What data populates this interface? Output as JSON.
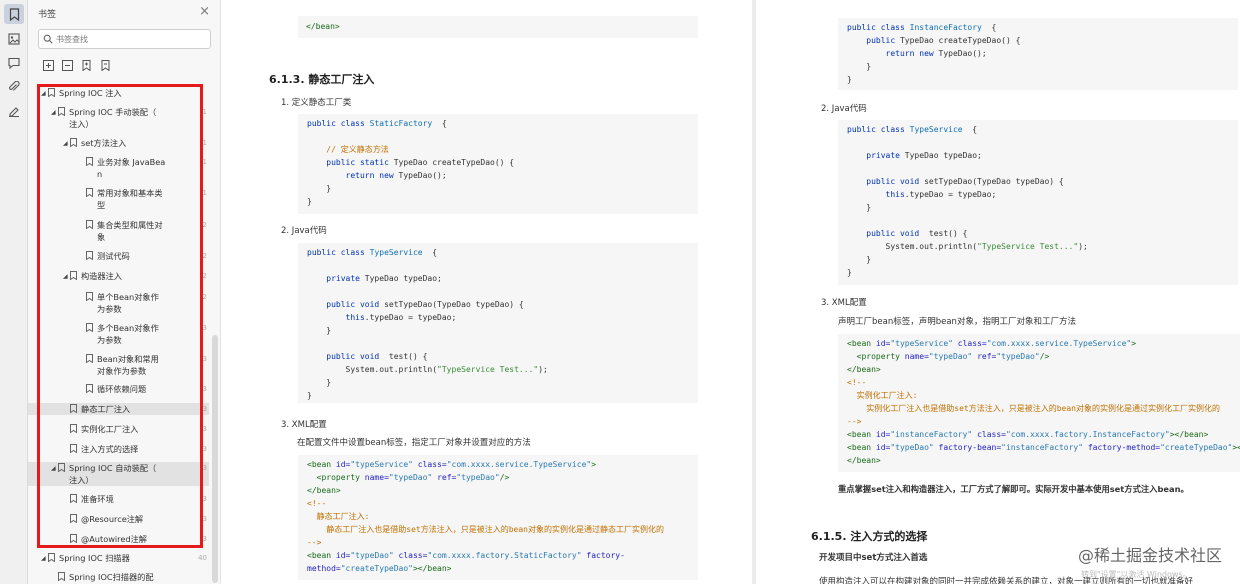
{
  "panel": {
    "title": "书签",
    "close": "×",
    "search_placeholder": "书签查找"
  },
  "tree": [
    {
      "label": "Spring IOC 注入",
      "level": 0,
      "exp": "open",
      "page": ""
    },
    {
      "label": "Spring IOC 手动装配（\n注入）",
      "level": 1,
      "exp": "open",
      "page": "1"
    },
    {
      "label": "set方法注入",
      "level": 2,
      "exp": "open",
      "page": "1"
    },
    {
      "label": "业务对象 JavaBea\nn",
      "level": 3,
      "exp": "",
      "page": "1"
    },
    {
      "label": "常用对象和基本类\n型",
      "level": 3,
      "exp": "",
      "page": "1"
    },
    {
      "label": "集合类型和属性对\n象",
      "level": 3,
      "exp": "",
      "page": "2"
    },
    {
      "label": "测试代码",
      "level": 3,
      "exp": "",
      "page": "2"
    },
    {
      "label": "构造器注入",
      "level": 2,
      "exp": "open",
      "page": "2"
    },
    {
      "label": "单个Bean对象作\n为参数",
      "level": 3,
      "exp": "",
      "page": "2"
    },
    {
      "label": "多个Bean对象作\n为参数",
      "level": 3,
      "exp": "",
      "page": "3"
    },
    {
      "label": "Bean对象和常用\n对象作为参数",
      "level": 3,
      "exp": "",
      "page": "3"
    },
    {
      "label": "循环依赖问题",
      "level": 3,
      "exp": "",
      "page": "3"
    },
    {
      "label": "静态工厂注入",
      "level": 2,
      "exp": "",
      "page": "3"
    },
    {
      "label": "实例化工厂注入",
      "level": 2,
      "exp": "",
      "page": "3"
    },
    {
      "label": "注入方式的选择",
      "level": 2,
      "exp": "",
      "page": "3"
    },
    {
      "label": "Spring IOC 自动装配（\n注入）",
      "level": 1,
      "exp": "open",
      "page": "3"
    },
    {
      "label": "准备环境",
      "level": 2,
      "exp": "",
      "page": "3"
    },
    {
      "label": "@Resource注解",
      "level": 2,
      "exp": "",
      "page": "3"
    },
    {
      "label": "@Autowired注解",
      "level": 2,
      "exp": "",
      "page": "3"
    },
    {
      "label": "Spring IOC 扫描器",
      "level": 0,
      "exp": "open",
      "page": "40"
    },
    {
      "label": "Spring IOC扫描器的配",
      "level": 1,
      "exp": "",
      "page": ""
    }
  ],
  "doc": {
    "p1_top_code": "</bean>",
    "h613": "6.1.3. 静态工厂注入",
    "i1": "1.   定义静态工厂类",
    "code1": [
      [
        [
          "kw",
          "public class "
        ],
        [
          "ty",
          "StaticFactory"
        ],
        [
          "",
          "  {"
        ]
      ],
      [
        [
          "",
          ""
        ]
      ],
      [
        [
          "cm",
          "    // 定义静态方法"
        ]
      ],
      [
        [
          "kw",
          "    public static "
        ],
        [
          "",
          "TypeDao createTypeDao() {"
        ]
      ],
      [
        [
          "kw",
          "        return new "
        ],
        [
          "",
          "TypeDao();"
        ]
      ],
      [
        [
          "",
          "    }"
        ]
      ],
      [
        [
          "",
          "}"
        ]
      ]
    ],
    "i2": "2.   Java代码",
    "code2": [
      [
        [
          "kw",
          "public class "
        ],
        [
          "ty",
          "TypeService"
        ],
        [
          "",
          "  {"
        ]
      ],
      [
        [
          "",
          ""
        ]
      ],
      [
        [
          "kw",
          "    private "
        ],
        [
          "",
          "TypeDao typeDao;"
        ]
      ],
      [
        [
          "",
          ""
        ]
      ],
      [
        [
          "kw",
          "    public void "
        ],
        [
          "",
          "setTypeDao(TypeDao typeDao) {"
        ]
      ],
      [
        [
          "kw",
          "        this"
        ],
        [
          "",
          ".typeDao = typeDao;"
        ]
      ],
      [
        [
          "",
          "    }"
        ]
      ],
      [
        [
          "",
          ""
        ]
      ],
      [
        [
          "kw",
          "    public void  "
        ],
        [
          "",
          "test() {"
        ]
      ],
      [
        [
          "",
          "        System.out.println("
        ],
        [
          "str",
          "\"TypeService Test...\""
        ],
        [
          "",
          ");"
        ]
      ],
      [
        [
          "",
          "    }"
        ]
      ],
      [
        [
          "",
          "}"
        ]
      ]
    ],
    "i3": "3.   XML配置",
    "p3": "在配置文件中设置bean标签，指定工厂对象并设置对应的方法",
    "code3": [
      [
        [
          "tag",
          "<bean "
        ],
        [
          "at",
          "id="
        ],
        [
          "av",
          "\"typeService\" "
        ],
        [
          "at",
          "class="
        ],
        [
          "av",
          "\"com.xxxx.service.TypeService\""
        ],
        [
          "tag",
          ">"
        ]
      ],
      [
        [
          "tag",
          "  <property "
        ],
        [
          "at",
          "name="
        ],
        [
          "av",
          "\"typeDao\" "
        ],
        [
          "at",
          "ref="
        ],
        [
          "av",
          "\"typeDao\""
        ],
        [
          "tag",
          "/>"
        ]
      ],
      [
        [
          "tag",
          "</bean>"
        ]
      ],
      [
        [
          "cm",
          "<!--"
        ]
      ],
      [
        [
          "cm",
          "  静态工厂注入:"
        ]
      ],
      [
        [
          "cm",
          "    静态工厂注入也是借助set方法注入，只是被注入的bean对象的实例化是通过静态工厂实例化的"
        ]
      ],
      [
        [
          "cm",
          "-->"
        ]
      ],
      [
        [
          "tag",
          "<bean "
        ],
        [
          "at",
          "id="
        ],
        [
          "av",
          "\"typeDao\" "
        ],
        [
          "at",
          "class="
        ],
        [
          "av",
          "\"com.xxxx.factory.StaticFactory\" "
        ],
        [
          "at",
          "factory-"
        ]
      ],
      [
        [
          "at",
          "method="
        ],
        [
          "av",
          "\"createTypeDao\""
        ],
        [
          "tag",
          "></bean>"
        ]
      ]
    ],
    "code4": [
      [
        [
          "kw",
          "public class "
        ],
        [
          "ty",
          "InstanceFactory"
        ],
        [
          "",
          "  {"
        ]
      ],
      [
        [
          "kw",
          "    public "
        ],
        [
          "",
          "TypeDao createTypeDao() {"
        ]
      ],
      [
        [
          "kw",
          "        return new "
        ],
        [
          "",
          "TypeDao();"
        ]
      ],
      [
        [
          "",
          "    }"
        ]
      ],
      [
        [
          "",
          "}"
        ]
      ]
    ],
    "j2": "2.   Java代码",
    "code5": [
      [
        [
          "kw",
          "public class "
        ],
        [
          "ty",
          "TypeService"
        ],
        [
          "",
          "  {"
        ]
      ],
      [
        [
          "",
          ""
        ]
      ],
      [
        [
          "kw",
          "    private "
        ],
        [
          "",
          "TypeDao typeDao;"
        ]
      ],
      [
        [
          "",
          ""
        ]
      ],
      [
        [
          "kw",
          "    public void "
        ],
        [
          "",
          "setTypeDao(TypeDao typeDao) {"
        ]
      ],
      [
        [
          "kw",
          "        this"
        ],
        [
          "",
          ".typeDao = typeDao;"
        ]
      ],
      [
        [
          "",
          "    }"
        ]
      ],
      [
        [
          "",
          ""
        ]
      ],
      [
        [
          "kw",
          "    public void  "
        ],
        [
          "",
          "test() {"
        ]
      ],
      [
        [
          "",
          "        System.out.println("
        ],
        [
          "str",
          "\"TypeService Test...\""
        ],
        [
          "",
          ");"
        ]
      ],
      [
        [
          "",
          "    }"
        ]
      ],
      [
        [
          "",
          "}"
        ]
      ]
    ],
    "j3": "3.   XML配置",
    "pj3": "声明工厂bean标签，声明bean对象，指明工厂对象和工厂方法",
    "code6": [
      [
        [
          "tag",
          "<bean "
        ],
        [
          "at",
          "id="
        ],
        [
          "av",
          "\"typeService\" "
        ],
        [
          "at",
          "class="
        ],
        [
          "av",
          "\"com.xxxx.service.TypeService\""
        ],
        [
          "tag",
          ">"
        ]
      ],
      [
        [
          "tag",
          "  <property "
        ],
        [
          "at",
          "name="
        ],
        [
          "av",
          "\"typeDao\" "
        ],
        [
          "at",
          "ref="
        ],
        [
          "av",
          "\"typeDao\""
        ],
        [
          "tag",
          "/>"
        ]
      ],
      [
        [
          "tag",
          "</bean>"
        ]
      ],
      [
        [
          "cm",
          "<!--"
        ]
      ],
      [
        [
          "cm",
          "  实例化工厂注入:"
        ]
      ],
      [
        [
          "cm",
          "    实例化工厂注入也是借助set方法注入，只是被注入的bean对象的实例化是通过实例化工厂实例化的"
        ]
      ],
      [
        [
          "cm",
          "-->"
        ]
      ],
      [
        [
          "tag",
          "<bean "
        ],
        [
          "at",
          "id="
        ],
        [
          "av",
          "\"instanceFactory\" "
        ],
        [
          "at",
          "class="
        ],
        [
          "av",
          "\"com.xxxx.factory.InstanceFactory\""
        ],
        [
          "tag",
          "></bean>"
        ]
      ],
      [
        [
          "tag",
          "<bean "
        ],
        [
          "at",
          "id="
        ],
        [
          "av",
          "\"typeDao\" "
        ],
        [
          "at",
          "factory-bean="
        ],
        [
          "av",
          "\"instanceFactory\" "
        ],
        [
          "at",
          "factory-method="
        ],
        [
          "av",
          "\"createTypeDao\""
        ],
        [
          "tag",
          "></bean>"
        ]
      ],
      [
        [
          "tag",
          "</bean>"
        ]
      ]
    ],
    "bold_note": "重点掌握set注入和构造器注入，工厂方式了解即可。实际开发中基本使用set方式注入bean。",
    "h615": "6.1.5. 注入方式的选择",
    "sub615": "开发项目中set方式注入首选",
    "para615": "使用构造注入可以在构建对象的同时一并完成依赖关系的建立，对象一建立则所有的一切也就准备好",
    "watermark": "@稀土掘金技术社区",
    "watermark2": "转到\"设置\"以激活 Windows。"
  }
}
